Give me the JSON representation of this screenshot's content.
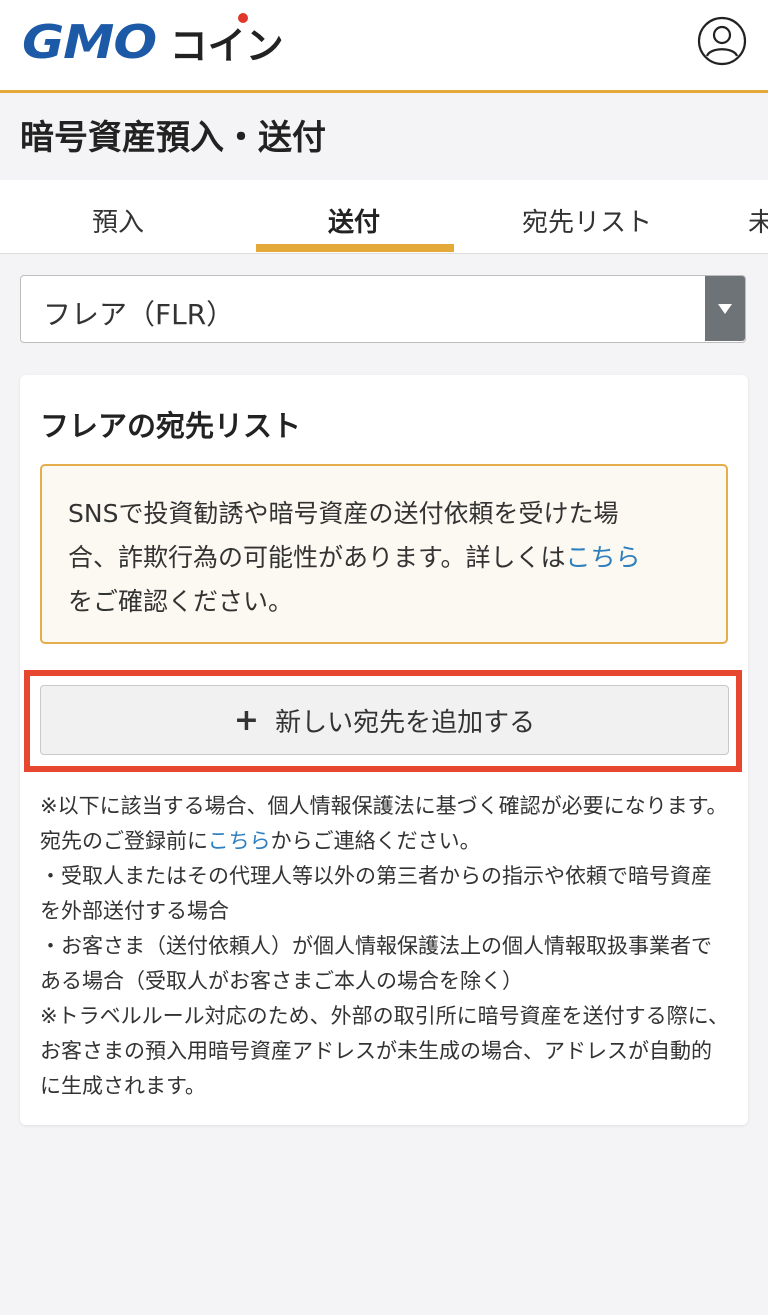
{
  "header": {
    "logo_gmo": "GMO",
    "logo_coin": "コイン"
  },
  "page_title": "暗号資産預入・送付",
  "tabs": [
    {
      "label": "預入",
      "active": false
    },
    {
      "label": "送付",
      "active": true
    },
    {
      "label": "宛先リスト",
      "active": false
    },
    {
      "label": "未",
      "active": false
    }
  ],
  "select": {
    "value": "フレア（FLR）"
  },
  "card": {
    "title": "フレアの宛先リスト",
    "warning": {
      "line1": "SNSで投資勧誘や暗号資産の送付依頼を受けた場",
      "line2_pre": "合、詐欺行為の可能性があります。詳しくは",
      "line2_link": "こちら",
      "line3": "をご確認ください。"
    },
    "add_button": {
      "icon": "+",
      "label": "新しい宛先を追加する"
    },
    "notes": {
      "p1_pre": "※以下に該当する場合、個人情報保護法に基づく確認が必要になります。宛先のご登録前に",
      "p1_link": "こちら",
      "p1_post": "からご連絡ください。",
      "p2": "・受取人またはその代理人等以外の第三者からの指示や依頼で暗号資産を外部送付する場合",
      "p3": "・お客さま（送付依頼人）が個人情報保護法上の個人情報取扱事業者である場合（受取人がお客さまご本人の場合を除く）",
      "p4": "※トラベルルール対応のため、外部の取引所に暗号資産を送付する際に、お客さまの預入用暗号資産アドレスが未生成の場合、アドレスが自動的に生成されます。"
    }
  },
  "colors": {
    "accent": "#e5a93a",
    "brand_blue": "#1c5aa8",
    "link": "#2f7fbf",
    "highlight": "#e8472f"
  },
  "icons": {
    "account": "user-circle-icon",
    "dropdown": "caret-down-icon",
    "add": "plus-icon"
  }
}
